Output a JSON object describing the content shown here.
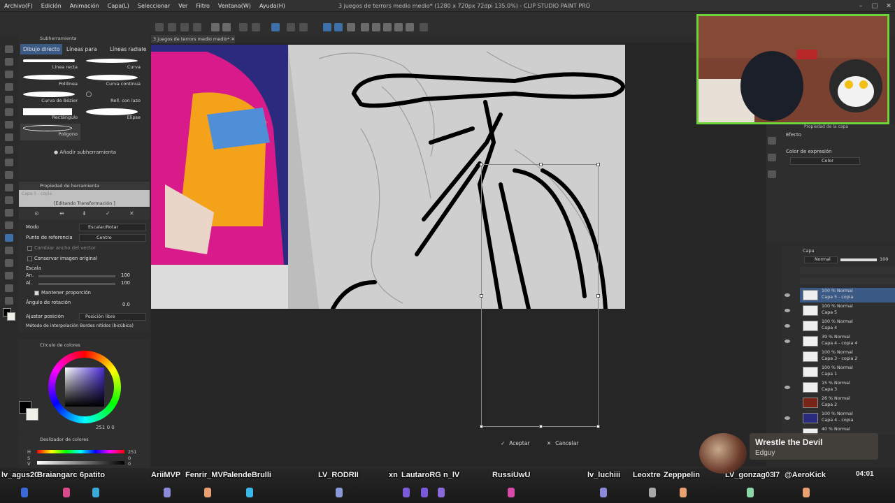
{
  "app": {
    "title": "3 juegos de terrors medio medio* (1280 x 720px 72dpi 135.0%) - CLIP STUDIO PAINT PRO"
  },
  "menu": [
    "Archivo(F)",
    "Edición",
    "Animación",
    "Capa(L)",
    "Seleccionar",
    "Ver",
    "Filtro",
    "Ventana(W)",
    "Ayuda(H)"
  ],
  "subtool_panel": {
    "tab": "Subherramienta",
    "tabs": [
      "Dibujo directo",
      "Líneas para",
      "Líneas radiale"
    ],
    "brushes": [
      "Línea recta",
      "Curva",
      "Polilínea",
      "Curva continua",
      "Curva de Bézier",
      "Rell. con lazo",
      "Rectángulo",
      "Elipse",
      "Polígono"
    ],
    "add_label": "Añadir subherramienta"
  },
  "tool_property": {
    "header": "Propiedad de herramienta",
    "preview_label": "Capa 5 - copia",
    "editing_label": "[Editando Transformación ]",
    "rows": {
      "mode_label": "Modo",
      "mode_value": "Escalar/Rotar",
      "ref_label": "Punto de referencia",
      "ref_value": "Centro",
      "change_width": "Cambiar ancho del vector",
      "keep_original": "Conservar imagen original",
      "scale_label": "Escala",
      "width_label": "An.",
      "width_value": "100",
      "height_label": "Al.",
      "height_value": "100",
      "keep_ratio": "Mantener proporción",
      "rotation_label": "Ángulo de rotación",
      "rotation_value": "0.0",
      "adjust_label": "Ajustar posición",
      "adjust_value": "Posición libre",
      "interp_label": "Método de interpolación",
      "interp_value": "Bordes nítidos (bicúbica)"
    }
  },
  "color_circle": {
    "header": "Círculo de colores",
    "values": "251  0  0"
  },
  "color_slider": {
    "header": "Deslizador de colores",
    "h_label": "H",
    "h_value": "251",
    "s_label": "S",
    "s_value": "0",
    "v_label": "V",
    "v_value": "0"
  },
  "canvas": {
    "tab_label": "3 juegos de terrors medio medio*",
    "accept": "Aceptar",
    "cancel": "Cancelar"
  },
  "layer_property": {
    "header": "Propiedad de la capa",
    "effect_label": "Efecto",
    "expression_label": "Color de expresión",
    "expression_value": "Color"
  },
  "layers": {
    "header": "Capa",
    "blend": "Normal",
    "opacity": "100",
    "items": [
      {
        "mode": "100 % Normal",
        "name": "Capa 5 - copia"
      },
      {
        "mode": "100 % Normal",
        "name": "Capa 5"
      },
      {
        "mode": "100 % Normal",
        "name": "Capa 4"
      },
      {
        "mode": "39 % Normal",
        "name": "Capa 4 - copia 4"
      },
      {
        "mode": "100 % Normal",
        "name": "Capa 3 - copia 2"
      },
      {
        "mode": "100 % Normal",
        "name": "Capa 1"
      },
      {
        "mode": "15 % Normal",
        "name": "Capa 3"
      },
      {
        "mode": "26 % Normal",
        "name": "Capa 2"
      },
      {
        "mode": "100 % Normal",
        "name": "Capa 4 - copia"
      },
      {
        "mode": "40 % Normal",
        "name": ""
      }
    ]
  },
  "now_playing": {
    "title": "Wrestle the Devil",
    "artist": "Edguy",
    "time": "04:01"
  },
  "viewers": [
    "lv_agus20",
    "Braiangarc",
    "6patito",
    "AriiMVP",
    "Fenrir_MVP",
    "alendeBrulli",
    "LV_RODRII",
    "xn",
    "LautaroRG",
    "n_lV",
    "RussiUwU",
    "lv_luchiii",
    "Leoxtre",
    "Zepppelin",
    "LV_gonzag03",
    "l7",
    "@AeroKick"
  ],
  "colors": {
    "accent": "#3b5a86",
    "webcam_border": "#6fd43a",
    "panel_bg": "#2e2e2e"
  }
}
